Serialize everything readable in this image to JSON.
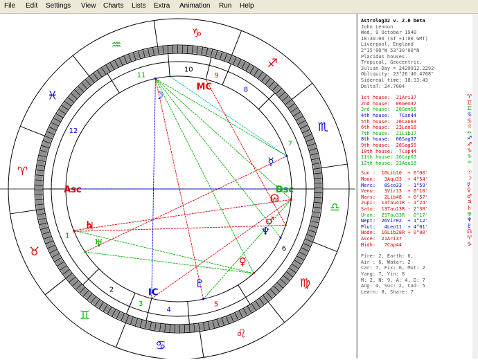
{
  "menu": [
    "File",
    "Edit",
    "Settings",
    "View",
    "Charts",
    "Lists",
    "Extra",
    "Animation",
    "Run",
    "Help"
  ],
  "info": {
    "lines": [
      "Astrolog32 v. 2.0 beta",
      "John Lennon",
      "Wed, 9 October 1940",
      "18:30:00 (ST +1:00 GMT)",
      "Liverpool, England",
      "2°15'00\"W 53°30'00\"N",
      "Placidus houses.",
      "Tropical, Geocentric.",
      "Julian Day = 2429912.2292",
      "Obliquity: 23°26'46.4768\"",
      "Sidereal time: 18:33:43",
      "DeltaT: 24.7004"
    ],
    "houses": [
      {
        "label": "1st house:  21Ari37",
        "color": "#e00000",
        "glyph": "♈"
      },
      {
        "label": "2nd house:  06Gem37",
        "color": "#e00000",
        "glyph": "♊"
      },
      {
        "label": "3rd house:  28Gem55",
        "color": "#00b000",
        "glyph": "♊"
      },
      {
        "label": "4th house:   7Can44",
        "color": "#0000e0",
        "glyph": "♋"
      },
      {
        "label": "5th house:  26Can03",
        "color": "#e00000",
        "glyph": "♋"
      },
      {
        "label": "6th house:  23Leo18",
        "color": "#e00000",
        "glyph": "♌"
      },
      {
        "label": "7th house:  21Lib37",
        "color": "#00b000",
        "glyph": "♎"
      },
      {
        "label": "8th house:  06Sag37",
        "color": "#0000e0",
        "glyph": "♐"
      },
      {
        "label": "9th house:  28Sag55",
        "color": "#e00000",
        "glyph": "♐"
      },
      {
        "label": "10th house:  7Cap44",
        "color": "#e00000",
        "glyph": "♑"
      },
      {
        "label": "11th house: 26Cap03",
        "color": "#00b000",
        "glyph": "♑"
      },
      {
        "label": "12th house: 23Aqu18",
        "color": "#00b000",
        "glyph": "♒"
      }
    ],
    "planets": [
      {
        "label": "Sun :  16Lib10  + 0°00'",
        "color": "#e00000",
        "glyph": "☉"
      },
      {
        "label": "Moon:   3Aqu33  + 4°54'",
        "color": "#e00000",
        "glyph": "☽"
      },
      {
        "label": "Merc:   8Sco33  - 1°59'",
        "color": "#0000e0",
        "glyph": "☿"
      },
      {
        "label": "Venu:   3Vir13  + 0°10'",
        "color": "#e00000",
        "glyph": "♀"
      },
      {
        "label": "Mars:   2Lib48  + 0°57'",
        "color": "#e00000",
        "glyph": "♂"
      },
      {
        "label": "Jupi:  13Tau41R - 1°24'",
        "color": "#e00000",
        "glyph": "♃"
      },
      {
        "label": "Satu:  13Tau13R - 2°38'",
        "color": "#e00000",
        "glyph": "♄"
      },
      {
        "label": "Uran:  25Tau33R - 0°17'",
        "color": "#00b000",
        "glyph": "♅"
      },
      {
        "label": "Nept:  26Vir02  + 1°12'",
        "color": "#0000e0",
        "glyph": "♆"
      },
      {
        "label": "Plut:   4Leo11  + 4°01'",
        "color": "#0000e0",
        "glyph": "♇"
      },
      {
        "label": "Node:  16Lib28R + 0°00'",
        "color": "#e00000",
        "glyph": "☊"
      },
      {
        "label": "Asce:  21Ari37",
        "color": "#e00000",
        "glyph": "♈"
      },
      {
        "label": "Midh:   7Cap44",
        "color": "#e00000",
        "glyph": "♑"
      }
    ],
    "summary": [
      "Fire: 2, Earth: 6,",
      "Air : 6, Water: 2",
      "Car: 7, Fix: 6, Mut: 2",
      "Yang: 7, Yin: 8",
      "M: 2, N: 9, A: 4, D: 7",
      "Ang: 4, Suc: 2, Cad: 5",
      "Learn: 8, Share: 7"
    ]
  },
  "wheel": {
    "ascendant": 21.6,
    "signs": [
      {
        "glyph": "♈",
        "color": "#e00000"
      },
      {
        "glyph": "♉",
        "color": "#e00000"
      },
      {
        "glyph": "♊",
        "color": "#00b000"
      },
      {
        "glyph": "♋",
        "color": "#0000e0"
      },
      {
        "glyph": "♌",
        "color": "#e00000"
      },
      {
        "glyph": "♍",
        "color": "#e00000"
      },
      {
        "glyph": "♎",
        "color": "#00b000"
      },
      {
        "glyph": "♏",
        "color": "#0000e0"
      },
      {
        "glyph": "♐",
        "color": "#e00000"
      },
      {
        "glyph": "♑",
        "color": "#e00000"
      },
      {
        "glyph": "♒",
        "color": "#00b000"
      },
      {
        "glyph": "♓",
        "color": "#0000e0"
      }
    ],
    "cusps": [
      21.6,
      66.6,
      88.9,
      97.7,
      116.1,
      143.3,
      201.6,
      246.6,
      268.9,
      277.7,
      296.1,
      323.3
    ],
    "house_numbers": [
      "1",
      "2",
      "3",
      "4",
      "5",
      "6",
      "7",
      "8",
      "9",
      "10",
      "11",
      "12"
    ],
    "house_colors": [
      "#e00000",
      "#000000",
      "#00b000",
      "#0000e0",
      "#e00000",
      "#000000",
      "#00b000",
      "#0000e0",
      "#e00000",
      "#000000",
      "#00b000",
      "#0000e0"
    ],
    "axis_labels": [
      {
        "text": "Asc",
        "lon": 21.6,
        "color": "#e00000"
      },
      {
        "text": "IC",
        "lon": 97.7,
        "color": "#0000e0"
      },
      {
        "text": "Dsc",
        "lon": 201.6,
        "color": "#00b000"
      },
      {
        "text": "MC",
        "lon": 277.7,
        "color": "#e00000"
      }
    ],
    "planets": [
      {
        "glyph": "☉",
        "lon": 196.2,
        "color": "#e00000"
      },
      {
        "glyph": "☽",
        "lon": 303.5,
        "color": "#0000e0"
      },
      {
        "glyph": "☿",
        "lon": 218.5,
        "color": "#0000e0"
      },
      {
        "glyph": "♀",
        "lon": 153.2,
        "color": "#e00000"
      },
      {
        "glyph": "♂",
        "lon": 182.8,
        "color": "#e00000"
      },
      {
        "glyph": "♃",
        "lon": 43.7,
        "color": "#e00000"
      },
      {
        "glyph": "♄",
        "lon": 43.2,
        "color": "#e00000"
      },
      {
        "glyph": "♅",
        "lon": 55.5,
        "color": "#00b000"
      },
      {
        "glyph": "♆",
        "lon": 176.0,
        "color": "#0000e0"
      },
      {
        "glyph": "♇",
        "lon": 124.2,
        "color": "#0000e0"
      },
      {
        "glyph": "☊",
        "lon": 196.5,
        "color": "#e00000"
      }
    ],
    "aspects": [
      {
        "a": 303.5,
        "b": 97.7,
        "color": "#0000e0"
      },
      {
        "a": 303.5,
        "b": 218.5,
        "color": "#00b000"
      },
      {
        "a": 303.5,
        "b": 196.2,
        "color": "#00b000"
      },
      {
        "a": 43.2,
        "b": 196.2,
        "color": "#e00000"
      },
      {
        "a": 43.7,
        "b": 182.8,
        "color": "#e00000"
      },
      {
        "a": 55.5,
        "b": 218.5,
        "color": "#e00000"
      },
      {
        "a": 124.2,
        "b": 196.2,
        "color": "#00b000"
      },
      {
        "a": 124.2,
        "b": 303.5,
        "color": "#e00000"
      },
      {
        "a": 153.2,
        "b": 43.2,
        "color": "#00b000"
      },
      {
        "a": 153.2,
        "b": 303.5,
        "color": "#00b000"
      },
      {
        "a": 176.0,
        "b": 303.5,
        "color": "#00b000"
      },
      {
        "a": 21.6,
        "b": 201.6,
        "color": "#0000e0"
      },
      {
        "a": 182.8,
        "b": 277.7,
        "color": "#e00000"
      },
      {
        "a": 218.5,
        "b": 296.1,
        "color": "#00c0c0"
      },
      {
        "a": 55.5,
        "b": 153.2,
        "color": "#00b000"
      },
      {
        "a": 97.7,
        "b": 196.2,
        "color": "#e00000"
      }
    ]
  }
}
